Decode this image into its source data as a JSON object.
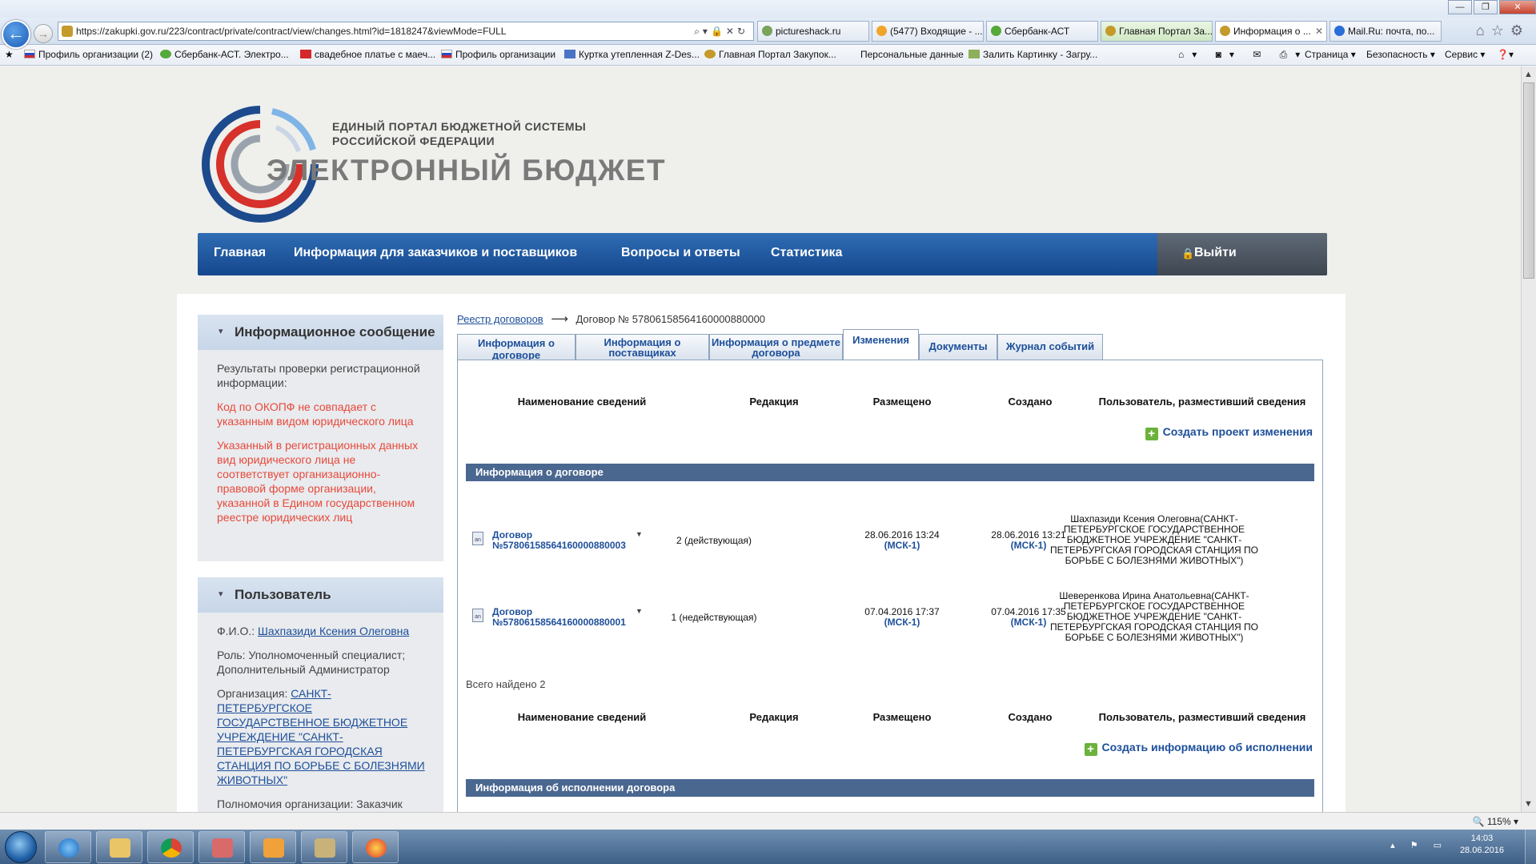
{
  "browser": {
    "url": "https://zakupki.gov.ru/223/contract/private/contract/view/changes.html?id=1818247&viewMode=FULL",
    "tabs": [
      {
        "label": "pictureshack.ru",
        "color": "#7aa35a"
      },
      {
        "label": "(5477) Входящие - ...",
        "color": "#f0a52a"
      },
      {
        "label": "Сбербанк-АСТ",
        "color": "#55a83a"
      },
      {
        "label": "Главная Портал За...",
        "color": "#c49a2a"
      },
      {
        "label": "Информация о ...",
        "color": "#c49a2a"
      },
      {
        "label": "Mail.Ru: почта, по...",
        "color": "#2a6ed8"
      }
    ],
    "favorites": [
      "Профиль организации (2)",
      "Сбербанк-АСТ. Электро...",
      "свадебное платье с маеч...",
      "Профиль организации",
      "Куртка утепленная Z-Des...",
      "Главная Портал Закупок...",
      "Персональные данные",
      "Залить Картинку - Загру..."
    ],
    "commands": {
      "page": "Страница ▾",
      "safety": "Безопасность ▾",
      "service": "Сервис ▾"
    },
    "zoom": "115%"
  },
  "header": {
    "line1": "ЕДИНЫЙ ПОРТАЛ БЮДЖЕТНОЙ СИСТЕМЫ",
    "line2": "РОССИЙСКОЙ ФЕДЕРАЦИИ",
    "brand": "ЭЛЕКТРОННЫЙ БЮДЖЕТ"
  },
  "nav": {
    "items": [
      "Главная",
      "Информация для заказчиков и поставщиков",
      "Вопросы и ответы",
      "Статистика"
    ],
    "logout": "Выйти"
  },
  "sidebar": {
    "info": {
      "title": "Информационное сообщение",
      "p1": "Результаты проверки регистрационной информации:",
      "p2": "Код по ОКОПФ не совпадает с указанным видом юридического лица",
      "p3": "Указанный в регистрационных данных вид юридического лица не соответствует организационно-правовой форме организации, указанной в Едином государственном реестре юридических лиц"
    },
    "user": {
      "title": "Пользователь",
      "fio_label": "Ф.И.О.:",
      "fio": "Шахпазиди Ксения Олеговна",
      "role": "Роль: Уполномоченный специалист; Дополнительный Администратор",
      "org_label": "Организация:",
      "org": "САНКТ-ПЕТЕРБУРГСКОЕ ГОСУДАРСТВЕННОЕ БЮДЖЕТНОЕ УЧРЕЖДЕНИЕ \"САНКТ-ПЕТЕРБУРГСКАЯ ГОРОДСКАЯ СТАНЦИЯ ПО БОРЬБЕ С БОЛЕЗНЯМИ ЖИВОТНЫХ\"",
      "powers": "Полномочия организации: Заказчик"
    }
  },
  "breadcrumb": {
    "registry": "Реестр договоров",
    "arrow": "⟶",
    "current": "Договор № 57806158564160000880000"
  },
  "tabs": [
    "Информация о договоре",
    "Информация о поставщиках",
    "Информация о предмете договора",
    "Изменения",
    "Документы",
    "Журнал событий"
  ],
  "table": {
    "headers": [
      "Наименование сведений",
      "Редакция",
      "Размещено",
      "Создано",
      "Пользователь, разместивший сведения"
    ],
    "add_change": "Создать проект изменения",
    "section1": "Информация о договоре",
    "rows": [
      {
        "doc_label": "Договор",
        "doc_number": "№57806158564160000880003",
        "edition": "2 (действующая)",
        "placed": "28.06.2016 13:24",
        "created": "28.06.2016 13:21",
        "tz": "(МСК-1)",
        "user": "Шахпазиди Ксения Олеговна(САНКТ-ПЕТЕРБУРГСКОЕ ГОСУДАРСТВЕННОЕ БЮДЖЕТНОЕ УЧРЕЖДЕНИЕ \"САНКТ-ПЕТЕРБУРГСКАЯ ГОРОДСКАЯ СТАНЦИЯ ПО БОРЬБЕ С БОЛЕЗНЯМИ ЖИВОТНЫХ\")"
      },
      {
        "doc_label": "Договор",
        "doc_number": "№57806158564160000880001",
        "edition": "1 (недействующая)",
        "placed": "07.04.2016 17:37",
        "created": "07.04.2016 17:35",
        "tz": "(МСК-1)",
        "user": "Шеверенкова Ирина Анатольевна(САНКТ-ПЕТЕРБУРГСКОЕ ГОСУДАРСТВЕННОЕ БЮДЖЕТНОЕ УЧРЕЖДЕНИЕ \"САНКТ-ПЕТЕРБУРГСКАЯ ГОРОДСКАЯ СТАНЦИЯ ПО БОРЬБЕ С БОЛЕЗНЯМИ ЖИВОТНЫХ\")"
      }
    ],
    "total": "Всего найдено 2",
    "add_exec": "Создать информацию об исполнении",
    "section2": "Информация об исполнении договора"
  },
  "taskbar": {
    "time": "14:03",
    "date": "28.06.2016"
  }
}
